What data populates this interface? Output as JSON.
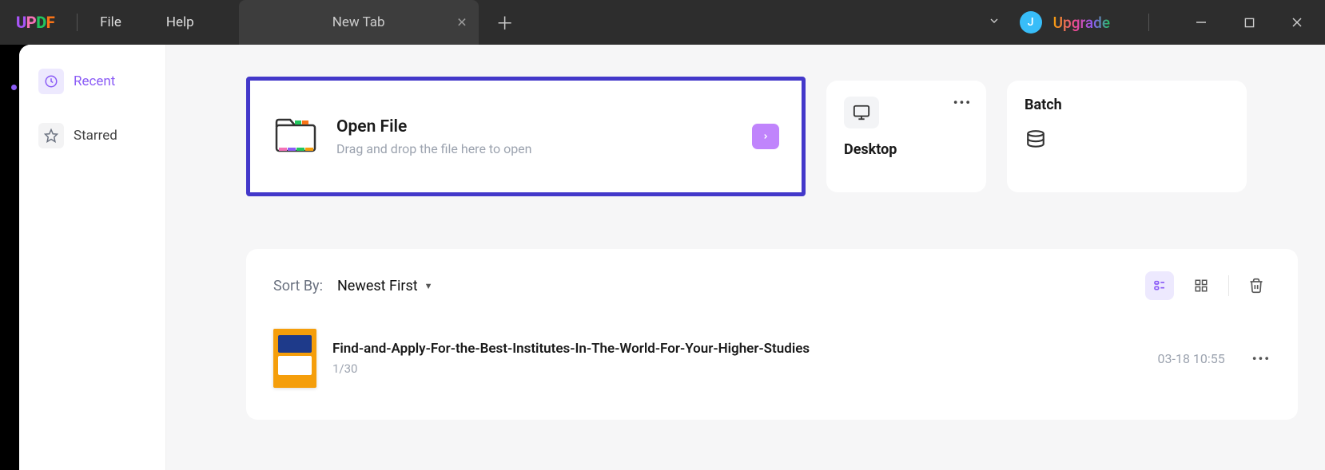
{
  "titlebar": {
    "logo_chars": [
      "U",
      "P",
      "D",
      "F"
    ],
    "menu": {
      "file": "File",
      "help": "Help"
    },
    "tab_label": "New Tab",
    "avatar_initial": "J",
    "upgrade": "Upgrade"
  },
  "sidebar": {
    "recent": "Recent",
    "starred": "Starred"
  },
  "open_file": {
    "title": "Open File",
    "subtitle": "Drag and drop the file here to open"
  },
  "cards": {
    "desktop": "Desktop",
    "batch": "Batch"
  },
  "list": {
    "sort_by_label": "Sort By:",
    "sort_value": "Newest First",
    "file": {
      "name": "Find-and-Apply-For-the-Best-Institutes-In-The-World-For-Your-Higher-Studies",
      "pages": "1/30",
      "date": "03-18 10:55"
    }
  }
}
